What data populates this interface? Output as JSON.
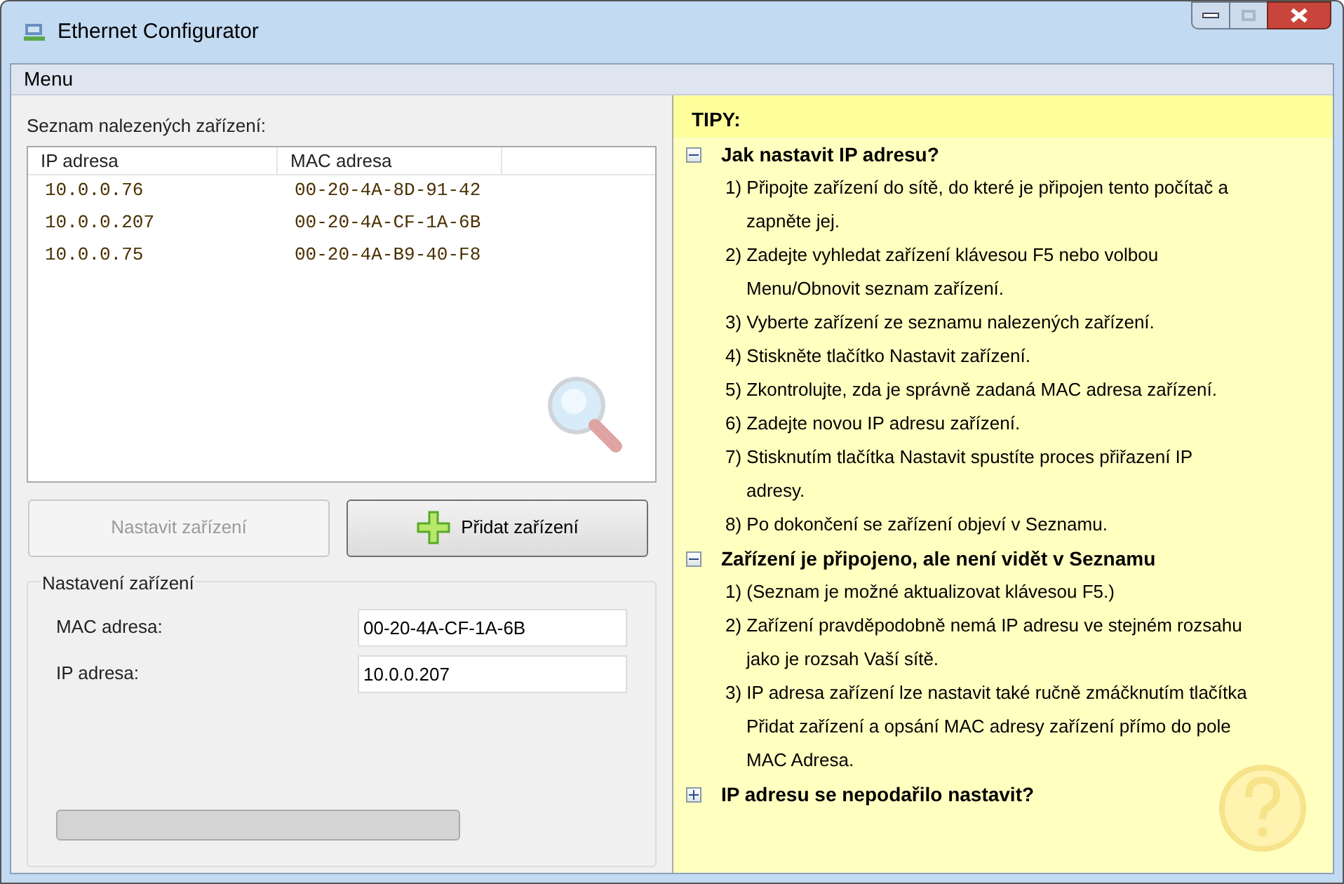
{
  "window": {
    "title": "Ethernet Configurator"
  },
  "menu": [
    {
      "label": "Menu"
    }
  ],
  "device_list": {
    "label": "Seznam nalezených zařízení:",
    "columns": [
      "IP adresa",
      "MAC adresa"
    ],
    "rows": [
      {
        "cells": [
          "10.0.0.76",
          "00-20-4A-8D-91-42"
        ],
        "selected": false
      },
      {
        "cells": [
          "10.0.0.207",
          "00-20-4A-CF-1A-6B"
        ],
        "selected": false
      },
      {
        "cells": [
          "10.0.0.75",
          "00-20-4A-B9-40-F8"
        ],
        "selected": false
      }
    ]
  },
  "buttons": [
    {
      "label": "Nastavit zařízení",
      "disabled": true,
      "kind": "plain"
    },
    {
      "label": "Přidat zařízení",
      "disabled": false,
      "kind": "add"
    }
  ],
  "settings": {
    "title": "Nastavení zařízení",
    "fields": [
      {
        "label": "MAC adresa:",
        "value": "00-20-4A-CF-1A-6B"
      },
      {
        "label": "IP adresa:",
        "value": "10.0.0.207"
      }
    ]
  },
  "tips": {
    "title": "TIPY:",
    "sections": [
      {
        "title": "Jak nastavit IP adresu?",
        "expanded": true,
        "items": [
          "1) Připojte zařízení do sítě, do které je připojen tento počítač a zapněte jej.",
          "2) Zadejte vyhledat zařízení klávesou F5 nebo volbou Menu/Obnovit seznam zařízení.",
          "3) Vyberte zařízení ze seznamu nalezených zařízení.",
          "4) Stiskněte tlačítko Nastavit zařízení.",
          "5) Zkontrolujte, zda je správně zadaná MAC adresa zařízení.",
          "6) Zadejte novou IP adresu zařízení.",
          "7) Stisknutím tlačítka Nastavit spustíte proces přiřazení IP adresy.",
          "8) Po dokončení se zařízení objeví v Seznamu."
        ]
      },
      {
        "title": "Zařízení je připojeno, ale není vidět v Seznamu",
        "expanded": true,
        "items": [
          "1) (Seznam je možné aktualizovat klávesou F5.)",
          "2) Zařízení pravděpodobně nemá IP adresu ve stejném rozsahu jako je rozsah Vaší sítě.",
          "3) IP adresa zařízení lze nastavit také ručně zmáčknutím tlačítka Přidat zařízení a opsání MAC adresy zařízení přímo do pole MAC Adresa."
        ]
      },
      {
        "title": "IP adresu se nepodařilo nastavit?",
        "expanded": false
      }
    ]
  }
}
